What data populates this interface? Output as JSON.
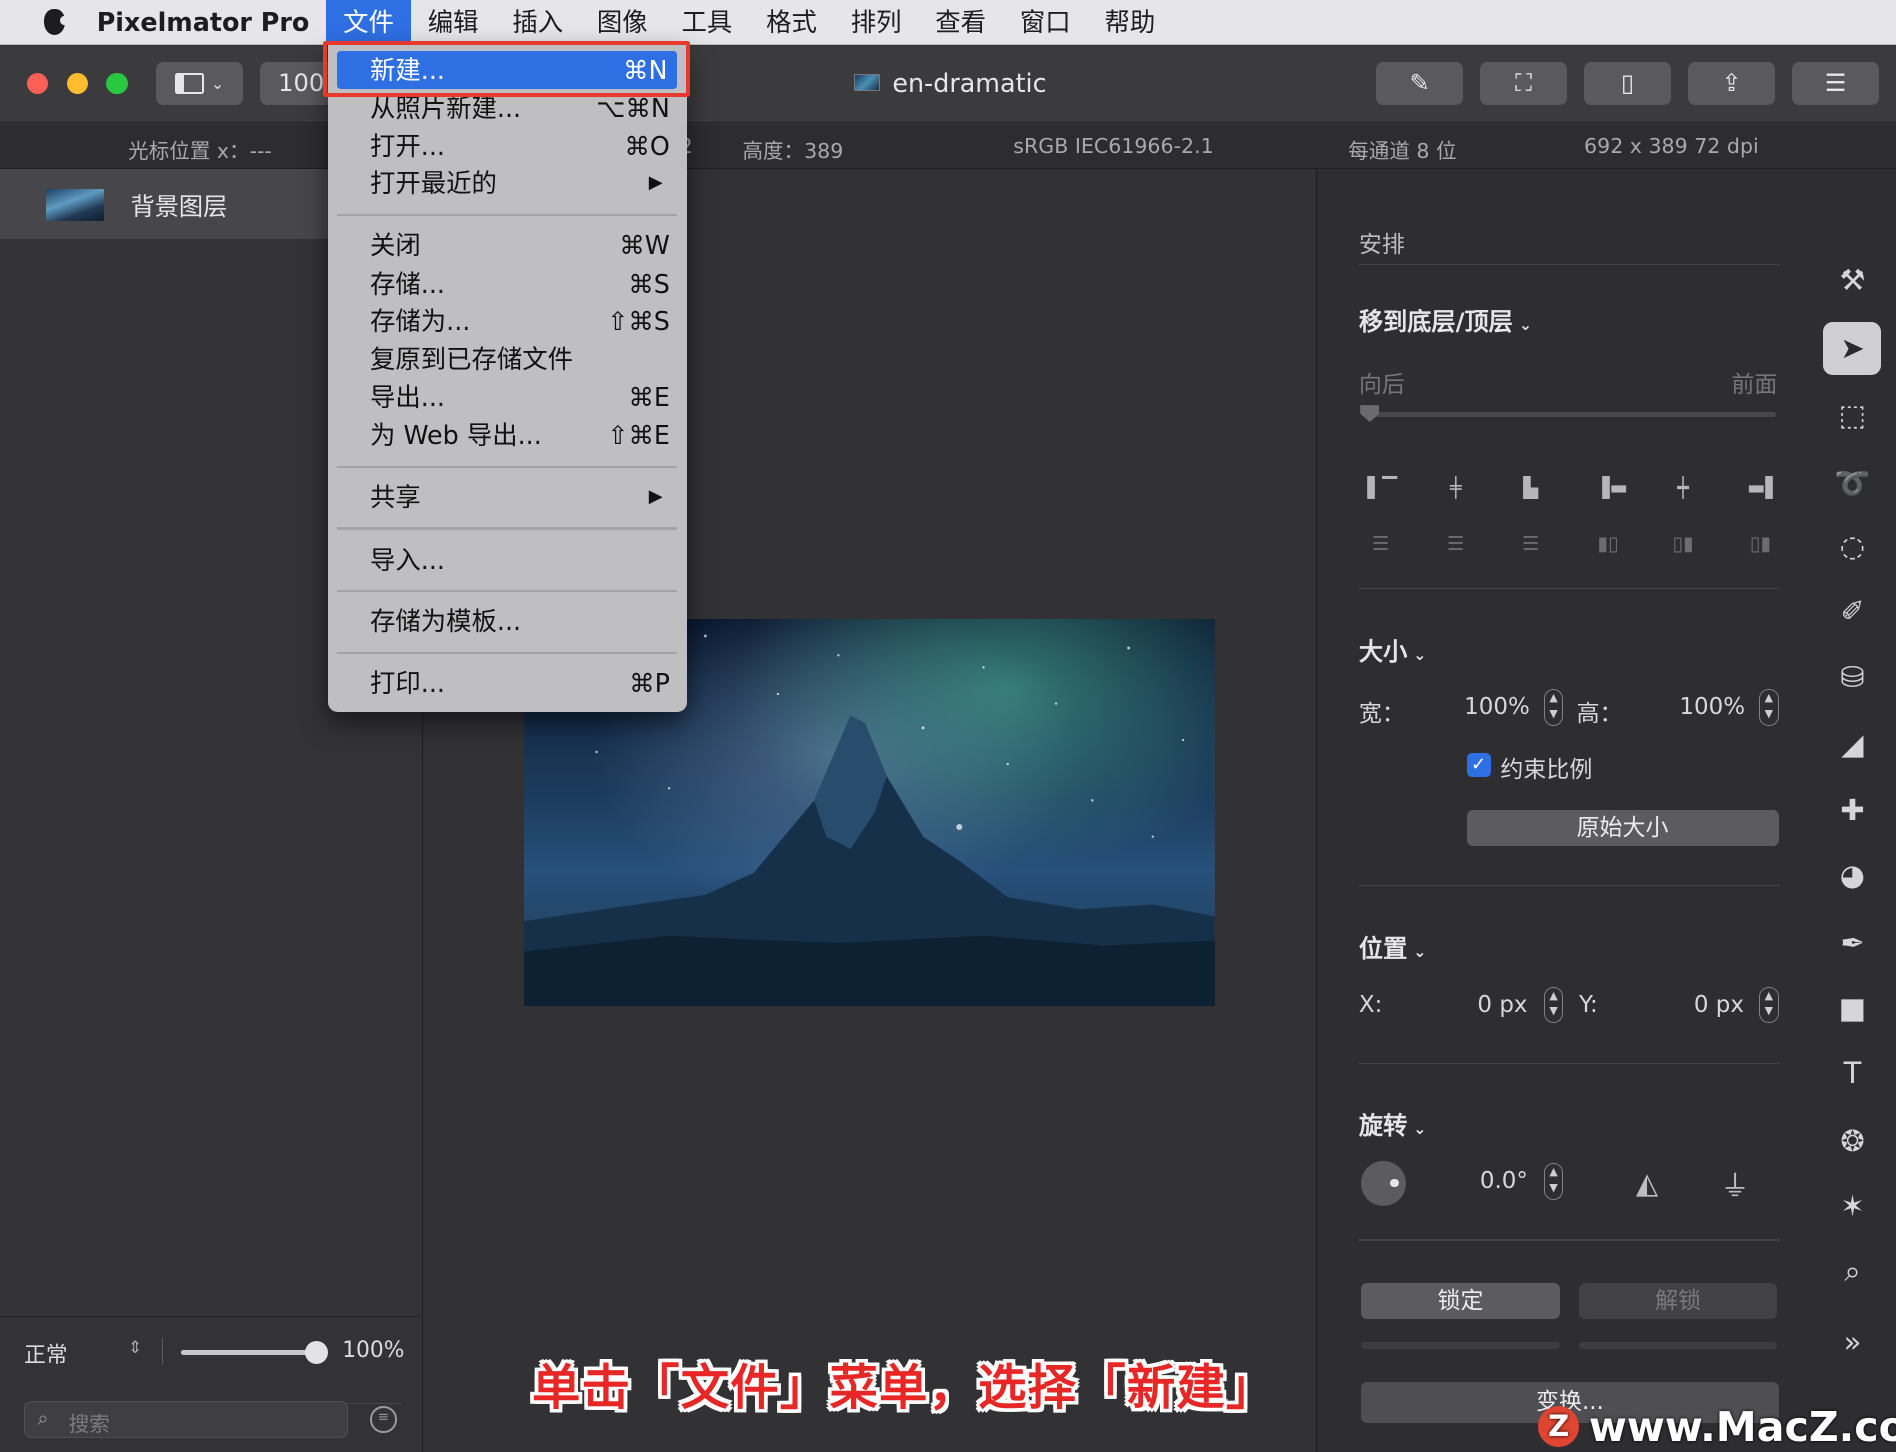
{
  "menubar": {
    "app_name": "Pixelmator Pro",
    "items": [
      "文件",
      "编辑",
      "插入",
      "图像",
      "工具",
      "格式",
      "排列",
      "查看",
      "窗口",
      "帮助"
    ]
  },
  "titlebar": {
    "zoom": "100",
    "document_title": "en-dramatic"
  },
  "infobar": {
    "cursor_x": "光标位置 x：---",
    "partial": "2",
    "height": "高度：389",
    "color_profile": "sRGB IEC61966-2.1",
    "bit_depth": "每通道 8 位",
    "size_dpi": "692 x 389 72 dpi"
  },
  "layers": {
    "items": [
      {
        "name": "背景图层"
      }
    ],
    "blend_mode": "正常",
    "opacity": "100%",
    "opacity_fraction": 1.0,
    "search_placeholder": "搜索"
  },
  "file_menu": {
    "items": [
      {
        "label": "新建...",
        "shortcut": "⌘N"
      },
      {
        "label": "从照片新建...",
        "shortcut": "⌥⌘N"
      },
      {
        "label": "打开...",
        "shortcut": "⌘O"
      },
      {
        "label": "打开最近的",
        "shortcut": "▶"
      },
      {
        "label": "关闭",
        "shortcut": "⌘W"
      },
      {
        "label": "存储...",
        "shortcut": "⌘S"
      },
      {
        "label": "存储为...",
        "shortcut": "⇧⌘S"
      },
      {
        "label": "复原到已存储文件",
        "shortcut": ""
      },
      {
        "label": "导出...",
        "shortcut": "⌘E"
      },
      {
        "label": "为 Web 导出...",
        "shortcut": "⇧⌘E"
      },
      {
        "label": "共享",
        "shortcut": "▶"
      },
      {
        "label": "导入...",
        "shortcut": ""
      },
      {
        "label": "存储为模板...",
        "shortcut": ""
      },
      {
        "label": "打印...",
        "shortcut": "⌘P"
      }
    ]
  },
  "arrange_panel": {
    "title": "安排",
    "move_section": "移到底层/顶层",
    "back_label": "向后",
    "front_label": "前面",
    "size_section": "大小",
    "width_label": "宽：",
    "width_value": "100%",
    "height_label": "高：",
    "height_value": "100%",
    "constrain_label": "约束比例",
    "original_size_button": "原始大小",
    "position_section": "位置",
    "x_label": "X:",
    "x_value": "0 px",
    "y_label": "Y:",
    "y_value": "0 px",
    "rotate_section": "旋转",
    "rotate_value": "0.0°",
    "lock_button": "锁定",
    "unlock_button": "解锁",
    "transform_button": "变换..."
  },
  "caption": "单击「文件」菜单，选择「新建」",
  "watermark": "www.MacZ.com",
  "colors": {
    "accent": "#2f6fe4",
    "highlight_box": "#e8392f",
    "caption": "#e72626"
  }
}
